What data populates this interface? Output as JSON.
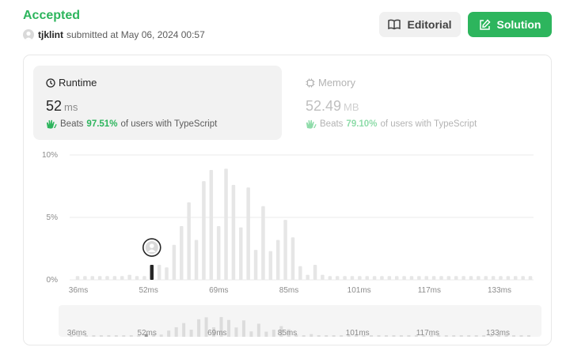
{
  "submission": {
    "status": "Accepted",
    "username": "tjklint",
    "submitted_text": "submitted at May 06, 2024 00:57"
  },
  "buttons": {
    "editorial": "Editorial",
    "solution": "Solution"
  },
  "runtime": {
    "label": "Runtime",
    "value": "52",
    "unit": "ms",
    "beats_prefix": "Beats",
    "beats_pct": "97.51%",
    "beats_suffix": "of users with TypeScript"
  },
  "memory": {
    "label": "Memory",
    "value": "52.49",
    "unit": "MB",
    "beats_prefix": "Beats",
    "beats_pct": "79.10%",
    "beats_suffix": "of users with TypeScript"
  },
  "colors": {
    "accent": "#2db55d",
    "bar": "#e6e6e6",
    "marker": "#262626"
  },
  "chart_data": {
    "type": "bar",
    "ylabel_ticks": [
      "0%",
      "5%",
      "10%"
    ],
    "ylim": [
      0,
      10
    ],
    "xtick_labels": [
      "36ms",
      "52ms",
      "69ms",
      "85ms",
      "101ms",
      "117ms",
      "133ms"
    ],
    "values": [
      0.3,
      0.3,
      0.3,
      0.3,
      0.3,
      0.3,
      0.3,
      0.4,
      0.3,
      0.3,
      1.2,
      1.2,
      1.0,
      2.8,
      4.3,
      6.2,
      3.2,
      7.9,
      8.8,
      4.3,
      8.9,
      7.6,
      4.2,
      7.4,
      2.4,
      5.9,
      2.3,
      3.2,
      4.8,
      3.4,
      1.1,
      0.4,
      1.2,
      0.4,
      0.3,
      0.3,
      0.3,
      0.3,
      0.3,
      0.3,
      0.3,
      0.3,
      0.3,
      0.3,
      0.3,
      0.3,
      0.3,
      0.3,
      0.3,
      0.3,
      0.3,
      0.3,
      0.3,
      0.3,
      0.3,
      0.3,
      0.3,
      0.3,
      0.3,
      0.3,
      0.3,
      0.3
    ],
    "highlight_index": 10,
    "grid": true
  }
}
